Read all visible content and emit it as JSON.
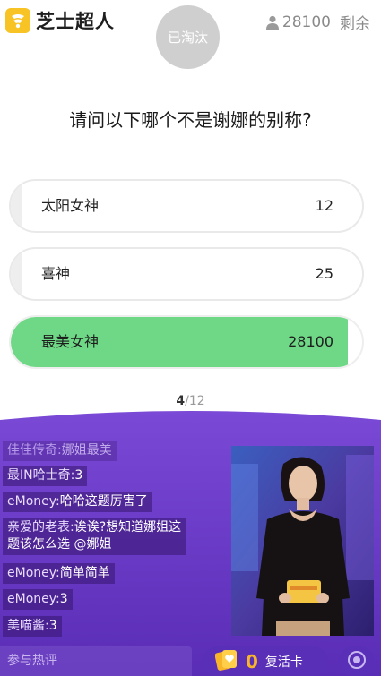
{
  "header": {
    "app_name": "芝士超人",
    "eliminated_label": "已淘汰",
    "remaining_count": "28100",
    "remaining_label": "剩余"
  },
  "question": "请问以下哪个不是谢娜的别称?",
  "options": [
    {
      "label": "太阳女神",
      "count": "12",
      "share": 0.0004,
      "correct": false
    },
    {
      "label": "喜神",
      "count": "25",
      "share": 0.0009,
      "correct": false
    },
    {
      "label": "最美女神",
      "count": "28100",
      "share": 0.96,
      "correct": true
    }
  ],
  "progress": {
    "current": "4",
    "sep": "/",
    "total": "12"
  },
  "chat": [
    {
      "user": "佳佳传奇:",
      "text": "娜姐最美"
    },
    {
      "user": "最IN哈士奇:",
      "text": "3"
    },
    {
      "user": "eMoney:",
      "text": "哈哈这题厉害了"
    },
    {
      "user": "亲爱的老表:",
      "text": "诶诶?想知道娜姐这",
      "text2": "题该怎么选 @娜姐"
    },
    {
      "user": "eMoney:",
      "text": "简单简单"
    },
    {
      "user": "eMoney:",
      "text": "3"
    },
    {
      "user": "美喵酱:",
      "text": "3"
    }
  ],
  "footer": {
    "input_placeholder": "参与热评",
    "revive_count": "0",
    "revive_label": "复活卡"
  },
  "colors": {
    "brand_yellow": "#f7c325",
    "correct_green": "#6fd886",
    "live_purple": "#6a3cc9",
    "revive_orange": "#f8b529"
  }
}
